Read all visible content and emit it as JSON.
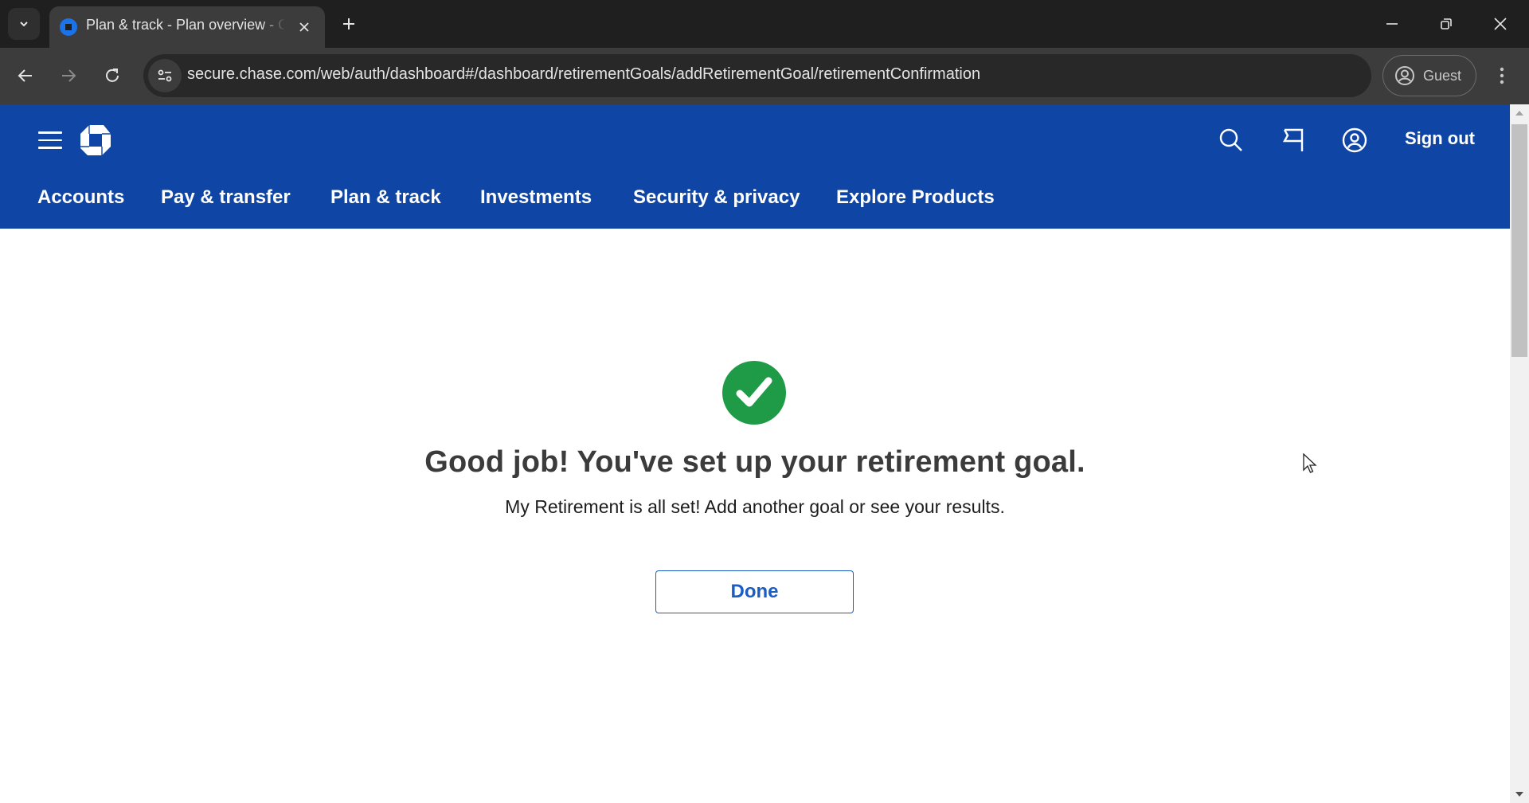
{
  "browser": {
    "tab": {
      "title": "Plan & track - Plan overview - Chase",
      "favicon": "chase-logo-icon"
    },
    "url": "secure.chase.com/web/auth/dashboard#/dashboard/retirementGoals/addRetirementGoal/retirementConfirmation",
    "profile_label": "Guest",
    "icons": {
      "tab_search": "chevron-down-icon",
      "new_tab": "plus-icon",
      "minimize": "minimize-icon",
      "restore": "restore-icon",
      "close": "close-icon",
      "back": "back-arrow-icon",
      "forward": "forward-arrow-icon",
      "reload": "reload-icon",
      "site_info": "tune-icon",
      "menu": "kebab-menu-icon"
    }
  },
  "header": {
    "brand": "Chase",
    "sign_out_label": "Sign out",
    "icons": [
      "menu-icon",
      "search-icon",
      "messages-flag-icon",
      "profile-icon"
    ],
    "nav": [
      {
        "label": "Accounts"
      },
      {
        "label": "Pay & transfer"
      },
      {
        "label": "Plan & track"
      },
      {
        "label": "Investments"
      },
      {
        "label": "Security & privacy"
      },
      {
        "label": "Explore Products"
      }
    ]
  },
  "confirmation": {
    "status_icon": "success-check-icon",
    "status_color": "#1f9b48",
    "headline": "Good job! You've set up your retirement goal.",
    "message": "My Retirement is all set! Add another goal or see your results.",
    "done_label": "Done"
  },
  "colors": {
    "brand_blue": "#0f46a6",
    "link_blue": "#1b5dc4"
  }
}
